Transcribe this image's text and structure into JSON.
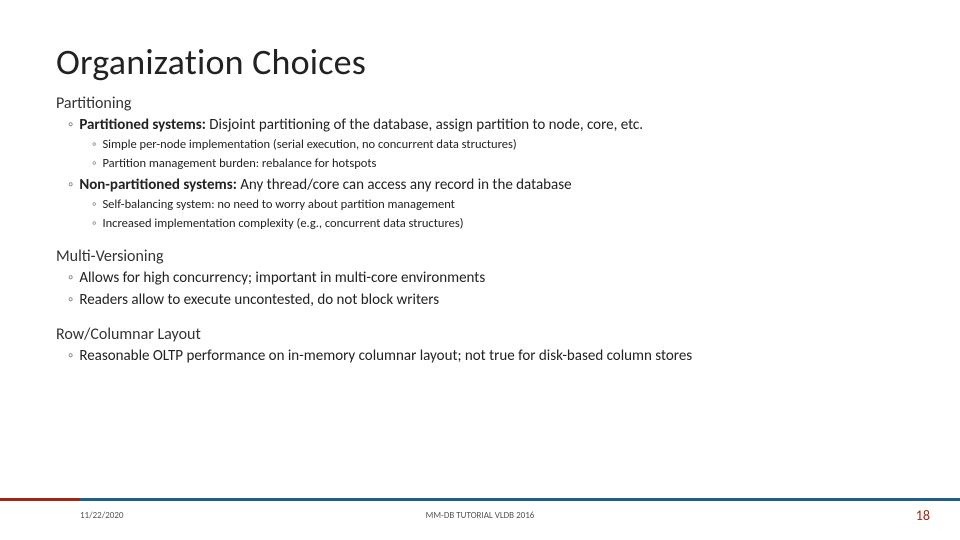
{
  "title": "Organization Choices",
  "sections": {
    "partitioning": {
      "head": "Partitioning",
      "item1_lead": "Partitioned systems:",
      "item1_rest": " Disjoint partitioning of the database, assign partition to node, core, etc.",
      "item1_sub1": "Simple per-node implementation (serial execution, no concurrent data structures)",
      "item1_sub2": "Partition management burden: rebalance for hotspots",
      "item2_lead": "Non-partitioned systems:",
      "item2_rest": " Any thread/core can access any record in the database",
      "item2_sub1": "Self-balancing system: no need to worry about partition management",
      "item2_sub2": "Increased implementation complexity (e.g., concurrent data structures)"
    },
    "multiversioning": {
      "head": "Multi-Versioning",
      "b1": "Allows for high concurrency; important in multi-core environments",
      "b2": "Readers allow to execute uncontested, do not block writers"
    },
    "layout": {
      "head": "Row/Columnar Layout",
      "b1": "Reasonable OLTP performance on in-memory columnar layout; not true for disk-based column stores"
    }
  },
  "footer": {
    "date": "11/22/2020",
    "center": "MM-DB TUTORIAL VLDB 2016",
    "page": "18"
  }
}
